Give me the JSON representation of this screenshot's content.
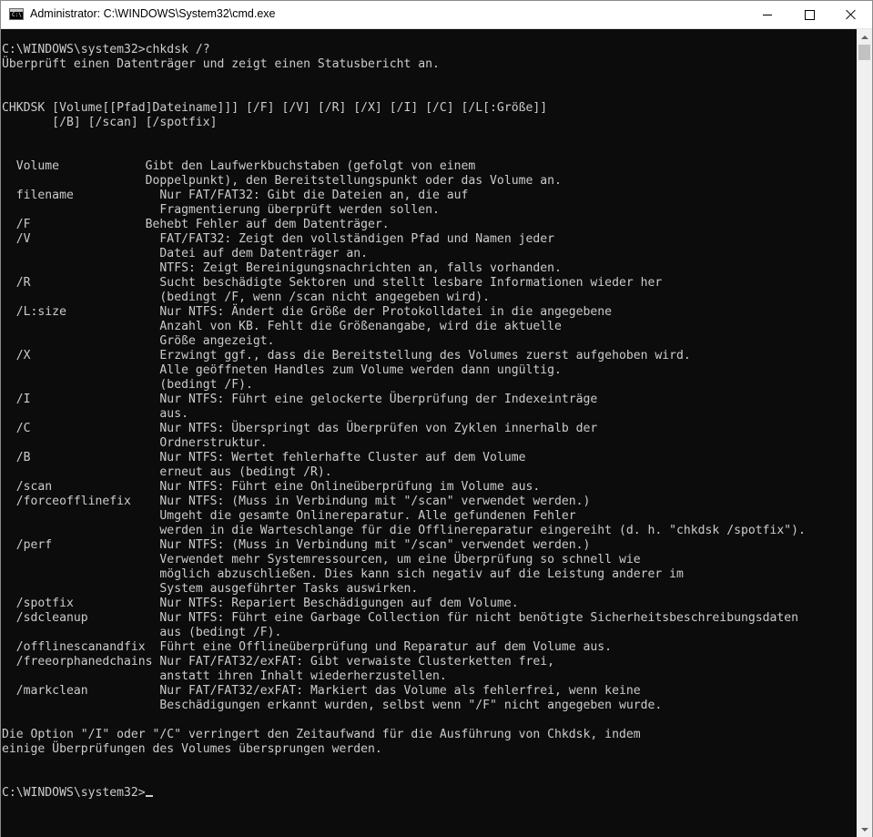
{
  "window": {
    "title": "Administrator: C:\\WINDOWS\\System32\\cmd.exe",
    "icon_prompt": "C:\\"
  },
  "titlebar_buttons": {
    "minimize": "minimize-icon",
    "maximize": "maximize-icon",
    "close": "close-icon"
  },
  "console": {
    "foreground": "#cccccc",
    "background": "#0c0c0c",
    "lines": [
      "C:\\WINDOWS\\system32>chkdsk /?",
      "Überprüft einen Datenträger und zeigt einen Statusbericht an.",
      "",
      "",
      "CHKDSK [Volume[[Pfad]Dateiname]]] [/F] [/V] [/R] [/X] [/I] [/C] [/L[:Größe]]",
      "       [/B] [/scan] [/spotfix]",
      "",
      "",
      "  Volume            Gibt den Laufwerkbuchstaben (gefolgt von einem",
      "                    Doppelpunkt), den Bereitstellungspunkt oder das Volume an.",
      "  filename            Nur FAT/FAT32: Gibt die Dateien an, die auf",
      "                      Fragmentierung überprüft werden sollen.",
      "  /F                Behebt Fehler auf dem Datenträger.",
      "  /V                  FAT/FAT32: Zeigt den vollständigen Pfad und Namen jeder",
      "                      Datei auf dem Datenträger an.",
      "                      NTFS: Zeigt Bereinigungsnachrichten an, falls vorhanden.",
      "  /R                  Sucht beschädigte Sektoren und stellt lesbare Informationen wieder her",
      "                      (bedingt /F, wenn /scan nicht angegeben wird).",
      "  /L:size             Nur NTFS: Ändert die Größe der Protokolldatei in die angegebene",
      "                      Anzahl von KB. Fehlt die Größenangabe, wird die aktuelle",
      "                      Größe angezeigt.",
      "  /X                  Erzwingt ggf., dass die Bereitstellung des Volumes zuerst aufgehoben wird.",
      "                      Alle geöffneten Handles zum Volume werden dann ungültig.",
      "                      (bedingt /F).",
      "  /I                  Nur NTFS: Führt eine gelockerte Überprüfung der Indexeinträge",
      "                      aus.",
      "  /C                  Nur NTFS: Überspringt das Überprüfen von Zyklen innerhalb der",
      "                      Ordnerstruktur.",
      "  /B                  Nur NTFS: Wertet fehlerhafte Cluster auf dem Volume",
      "                      erneut aus (bedingt /R).",
      "  /scan               Nur NTFS: Führt eine Onlineüberprüfung im Volume aus.",
      "  /forceofflinefix    Nur NTFS: (Muss in Verbindung mit \"/scan\" verwendet werden.)",
      "                      Umgeht die gesamte Onlinereparatur. Alle gefundenen Fehler",
      "                      werden in die Warteschlange für die Offlinereparatur eingereiht (d. h. \"chkdsk /spotfix\").",
      "  /perf               Nur NTFS: (Muss in Verbindung mit \"/scan\" verwendet werden.)",
      "                      Verwendet mehr Systemressourcen, um eine Überprüfung so schnell wie",
      "                      möglich abzuschließen. Dies kann sich negativ auf die Leistung anderer im",
      "                      System ausgeführter Tasks auswirken.",
      "  /spotfix            Nur NTFS: Repariert Beschädigungen auf dem Volume.",
      "  /sdcleanup          Nur NTFS: Führt eine Garbage Collection für nicht benötigte Sicherheitsbeschreibungsdaten",
      "                      aus (bedingt /F).",
      "  /offlinescanandfix  Führt eine Offlineüberprüfung und Reparatur auf dem Volume aus.",
      "  /freeorphanedchains Nur FAT/FAT32/exFAT: Gibt verwaiste Clusterketten frei,",
      "                      anstatt ihren Inhalt wiederherzustellen.",
      "  /markclean          Nur FAT/FAT32/exFAT: Markiert das Volume als fehlerfrei, wenn keine",
      "                      Beschädigungen erkannt wurden, selbst wenn \"/F\" nicht angegeben wurde.",
      "",
      "Die Option \"/I\" oder \"/C\" verringert den Zeitaufwand für die Ausführung von Chkdsk, indem",
      "einige Überprüfungen des Volumes übersprungen werden.",
      "",
      ""
    ],
    "prompt": "C:\\WINDOWS\\system32>"
  }
}
